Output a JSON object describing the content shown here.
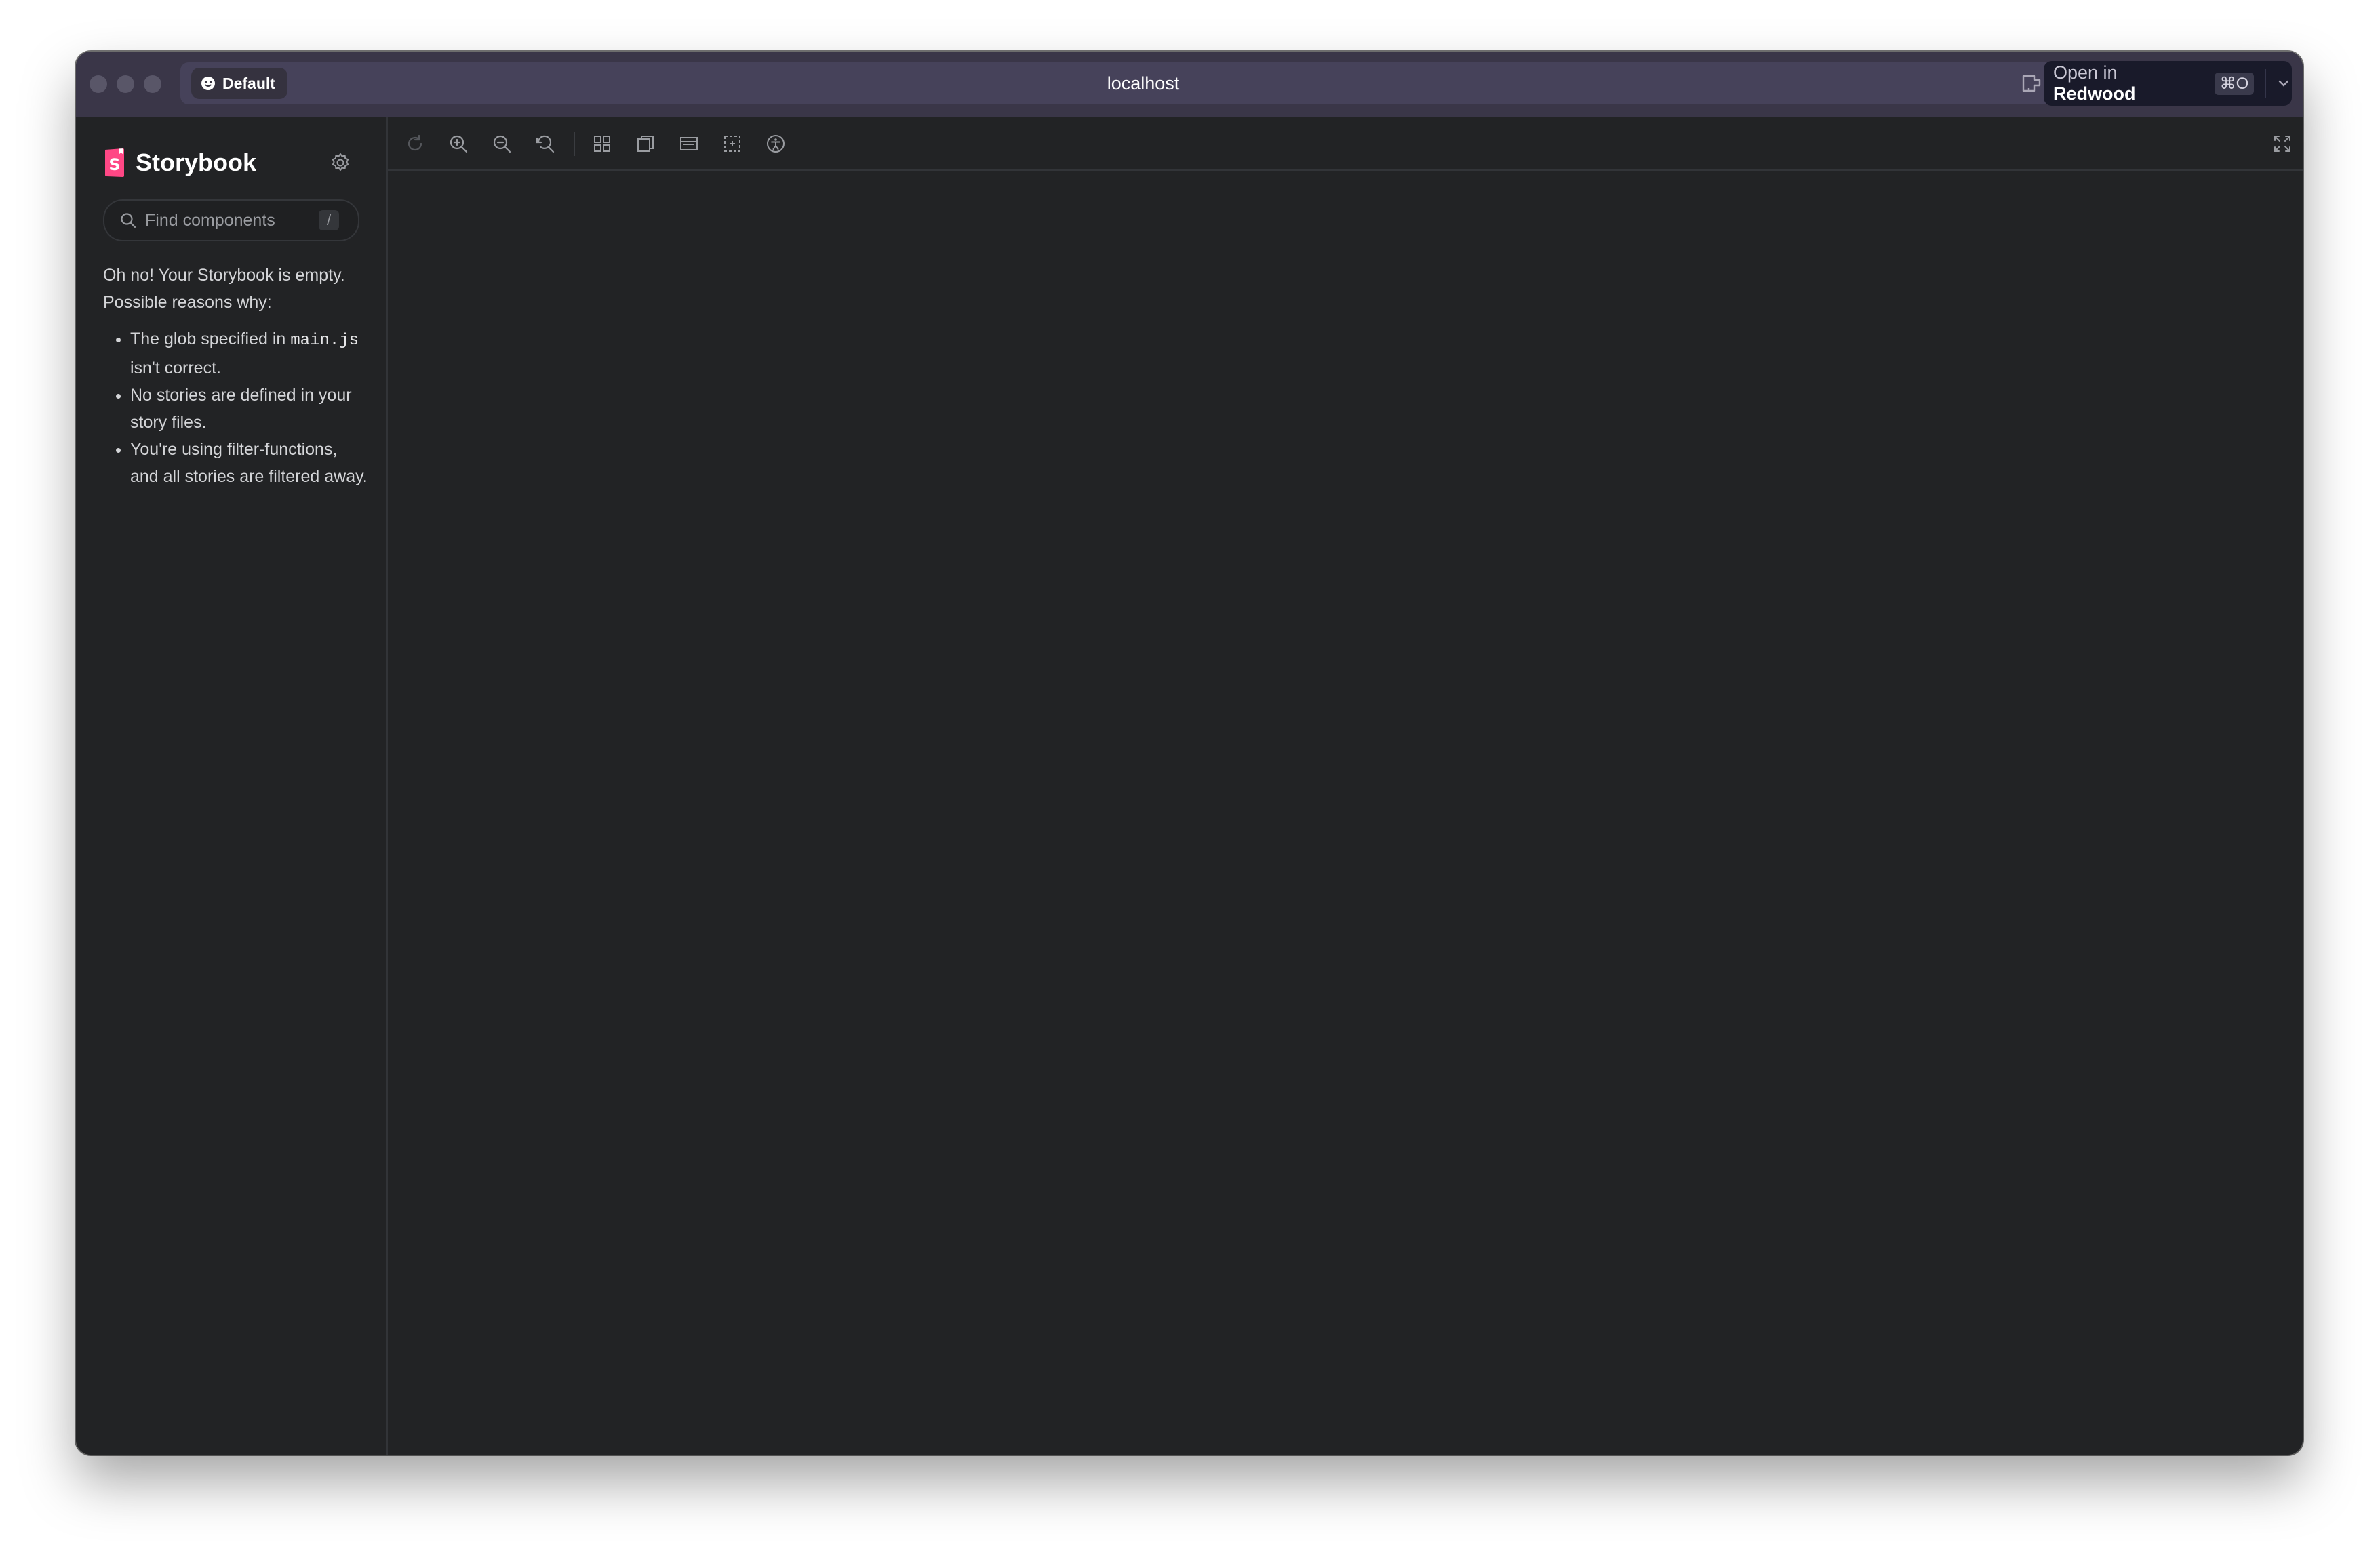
{
  "browser": {
    "profile": "Default",
    "url": "localhost",
    "open_in": {
      "prefix": "Open in",
      "app": "Redwood",
      "shortcut": "⌘O"
    },
    "icons": [
      "extension-icon",
      "link-icon",
      "chevron-down-icon"
    ]
  },
  "sidebar": {
    "brand": "Storybook",
    "search_placeholder": "Find components",
    "search_shortcut": "/",
    "empty_intro": "Oh no! Your Storybook is empty. Possible reasons why:",
    "reason_1_pre": "The glob specified in",
    "reason_1_code": "main.js",
    "reason_1_post": "isn't correct.",
    "reason_2": "No stories are defined in your story files.",
    "reason_3": "You're using filter-functions, and all stories are filtered away."
  },
  "toolbar": {
    "tools": [
      "reload-icon",
      "zoom-in-icon",
      "zoom-out-icon",
      "zoom-reset-icon",
      "grid-icon",
      "background-icon",
      "viewport-icon",
      "outline-icon",
      "accessibility-icon",
      "fullscreen-icon"
    ]
  },
  "colors": {
    "titlebar": "#3a3648",
    "app_bg": "#222325",
    "brand_pink": "#ff4785"
  }
}
